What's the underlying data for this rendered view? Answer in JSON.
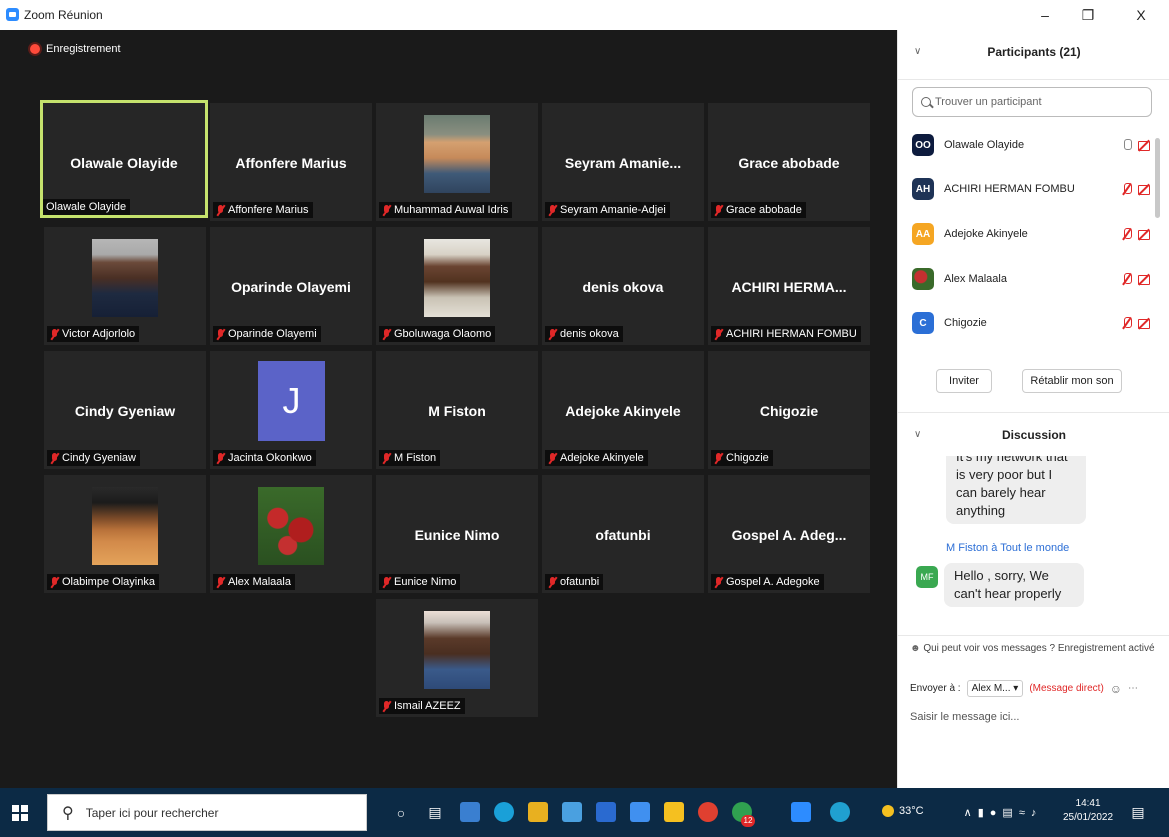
{
  "window": {
    "title": "Zoom Réunion",
    "controls": [
      "–",
      "❐",
      "X"
    ]
  },
  "recording": {
    "label": "Enregistrement"
  },
  "tiles": [
    {
      "big": "Olawale Olayide",
      "tag": "Olawale Olayide",
      "muted": false,
      "active": true
    },
    {
      "big": "Affonfere Marius",
      "tag": "Affonfere Marius",
      "muted": true
    },
    {
      "big": "",
      "tag": "Muhammad Auwal Idris",
      "muted": true,
      "photo": "baby-photo"
    },
    {
      "big": "Seyram  Amanie...",
      "tag": "Seyram Amanie-Adjei",
      "muted": true
    },
    {
      "big": "Grace abobade",
      "tag": "Grace abobade",
      "muted": true
    },
    {
      "big": "",
      "tag": "Victor Adjorlolo",
      "muted": true,
      "photo": "man-suit-photo"
    },
    {
      "big": "Oparinde Olayemi",
      "tag": "Oparinde Olayemi",
      "muted": true
    },
    {
      "big": "",
      "tag": "Gboluwaga Olaomo",
      "muted": true,
      "photo": "man-photo"
    },
    {
      "big": "denis okova",
      "tag": "denis okova",
      "muted": true
    },
    {
      "big": "ACHIRI  HERMA...",
      "tag": "ACHIRI HERMAN FOMBU",
      "muted": true
    },
    {
      "big": "Cindy Gyeniaw",
      "tag": "Cindy Gyeniaw",
      "muted": true
    },
    {
      "big": "",
      "tag": "Jacinta Okonkwo",
      "muted": true,
      "initial": "J"
    },
    {
      "big": "M Fiston",
      "tag": "M Fiston",
      "muted": true
    },
    {
      "big": "Adejoke Akinyele",
      "tag": "Adejoke Akinyele",
      "muted": true
    },
    {
      "big": "Chigozie",
      "tag": "Chigozie",
      "muted": true
    },
    {
      "big": "",
      "tag": "Olabimpe Olayinka",
      "muted": true,
      "photo": "woman-photo"
    },
    {
      "big": "",
      "tag": "Alex Malaala",
      "muted": true,
      "photo": "apples-photo"
    },
    {
      "big": "Eunice Nimo",
      "tag": "Eunice Nimo",
      "muted": true
    },
    {
      "big": "ofatunbi",
      "tag": "ofatunbi",
      "muted": true
    },
    {
      "big": "Gospel A. Adeg...",
      "tag": "Gospel A. Adegoke",
      "muted": true
    },
    {
      "big": "",
      "tag": "Ismail AZEEZ",
      "muted": true,
      "photo": "man-cap-photo"
    }
  ],
  "participants_panel": {
    "title": "Participants (21)",
    "search_placeholder": "Trouver un participant",
    "list": [
      {
        "initials": "OO",
        "name": "Olawale Olayide",
        "color": "#0d1b3e",
        "mic": "on"
      },
      {
        "initials": "AH",
        "name": "ACHIRI HERMAN FOMBU",
        "color": "#1e3356",
        "mic": "off"
      },
      {
        "initials": "AA",
        "name": "Adejoke Akinyele",
        "color": "#f5a623",
        "mic": "off"
      },
      {
        "initials": "",
        "name": "Alex Malaala",
        "color": "#8a2a2a",
        "mic": "off"
      },
      {
        "initials": "C",
        "name": "Chigozie",
        "color": "#2b6fd6",
        "mic": "off"
      }
    ],
    "invite_label": "Inviter",
    "unmute_label": "Rétablir mon son"
  },
  "chat": {
    "title": "Discussion",
    "prev_message": "It's my network that is very poor but I can barely hear anything",
    "sender": "M Fiston à Tout le monde",
    "sender_initials": "MF",
    "message": "Hello , sorry, We can't hear properly",
    "who_sees": "Qui peut voir vos messages ? Enregistrement activé",
    "send_to_label": "Envoyer à :",
    "send_to_value": "Alex M...",
    "direct_label": "(Message direct)",
    "input_placeholder": "Saisir le message ici..."
  },
  "taskbar": {
    "search_placeholder": "Taper ici pour rechercher",
    "temperature": "33°C",
    "time": "14:41",
    "date": "25/01/2022",
    "badge": "12"
  }
}
